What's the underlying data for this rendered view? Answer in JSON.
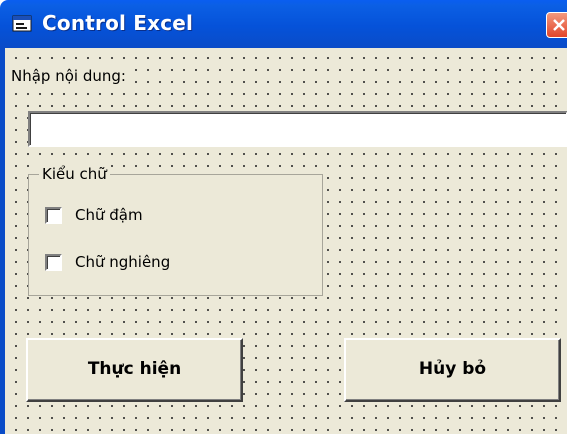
{
  "window": {
    "title": "Control Excel"
  },
  "form": {
    "content_label": "Nhập nội dung:",
    "content_value": "",
    "style_frame": {
      "title": "Kiểu chữ",
      "options": [
        {
          "label": "Chữ đậm",
          "checked": false
        },
        {
          "label": "Chữ nghiêng",
          "checked": false
        }
      ]
    },
    "buttons": {
      "run_label": "Thực hiện",
      "cancel_label": "Hủy bỏ"
    }
  },
  "colors": {
    "titlebar": "#0552d9",
    "form_background": "#ece9d8",
    "close_button": "#e2452a"
  },
  "icons": {
    "window_icon": "form-window-icon",
    "close_icon": "close-x-icon"
  }
}
